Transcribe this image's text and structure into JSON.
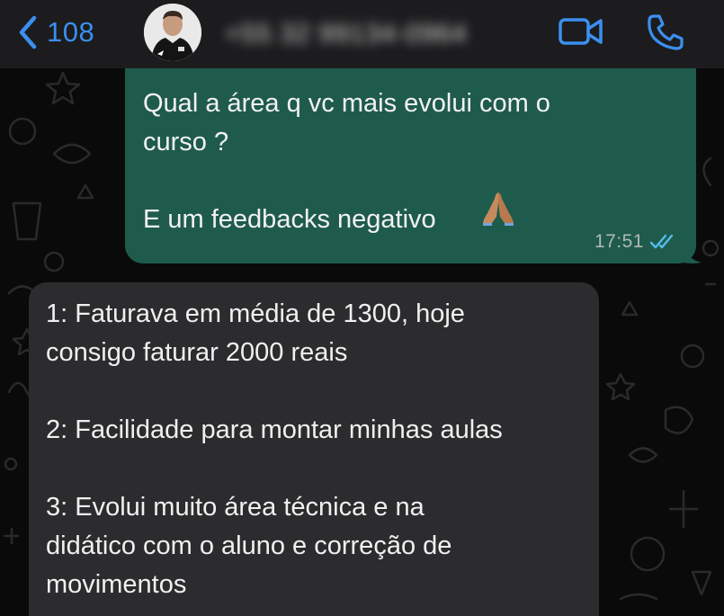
{
  "header": {
    "back_count": "108",
    "contact_name": "+55 32 99134-0964"
  },
  "messages": [
    {
      "direction": "outgoing",
      "lines": [
        "Qual a área q vc mais evolui com o",
        "curso ?",
        "",
        "E um feedbacks negativo"
      ],
      "emoji": "folded-hands",
      "time": "17:51",
      "status": "read"
    },
    {
      "direction": "incoming",
      "lines": [
        "1: Faturava em média de 1300, hoje",
        "consigo faturar 2000 reais",
        "",
        "2: Facilidade para montar minhas aulas",
        "",
        "3: Evolui muito área técnica e na",
        "didático com o aluno e correção de",
        "movimentos"
      ]
    }
  ],
  "colors": {
    "accent": "#3b8ff0",
    "outgoing_bubble": "#1f5b4c",
    "incoming_bubble": "#2c2c2e",
    "header": "#1c1c1e",
    "read_ticks": "#53bdeb"
  }
}
